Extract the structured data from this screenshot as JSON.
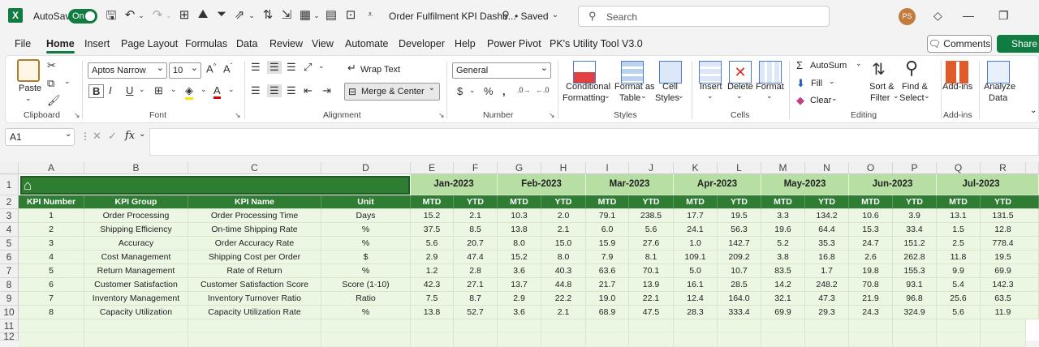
{
  "app": {
    "logo": "X",
    "autosave_label": "AutoSave",
    "autosave_state": "On",
    "doc_title": "Order Fulfilment KPI Dashb...",
    "save_status": "• Saved",
    "search_placeholder": "Search",
    "user_initials": "PS"
  },
  "tabs": [
    "File",
    "Home",
    "Insert",
    "Page Layout",
    "Formulas",
    "Data",
    "Review",
    "View",
    "Automate",
    "Developer",
    "Help",
    "Power Pivot",
    "PK's Utility Tool V3.0"
  ],
  "active_tab": "Home",
  "comments_label": "Comments",
  "share_label": "Share",
  "ribbon": {
    "clipboard": {
      "paste": "Paste",
      "label": "Clipboard"
    },
    "font": {
      "name": "Aptos Narrow",
      "size": "10",
      "label": "Font"
    },
    "alignment": {
      "wrap": "Wrap Text",
      "merge": "Merge & Center",
      "label": "Alignment"
    },
    "number": {
      "format": "General",
      "label": "Number"
    },
    "styles": {
      "cond1": "Conditional",
      "cond2": "Formatting",
      "fmt1": "Format as",
      "fmt2": "Table",
      "cell1": "Cell",
      "cell2": "Styles",
      "label": "Styles"
    },
    "cells": {
      "insert": "Insert",
      "delete": "Delete",
      "format": "Format",
      "label": "Cells"
    },
    "editing": {
      "autosum": "AutoSum",
      "fill": "Fill",
      "clear": "Clear",
      "sort1": "Sort &",
      "sort2": "Filter",
      "find1": "Find &",
      "find2": "Select",
      "label": "Editing"
    },
    "addins": {
      "addins": "Add-ins",
      "label": "Add-ins"
    },
    "analyze": {
      "l1": "Analyze",
      "l2": "Data"
    }
  },
  "formula_bar": {
    "name_box": "A1",
    "fx": "fx",
    "value": ""
  },
  "sheet": {
    "columns": [
      "A",
      "B",
      "C",
      "D",
      "E",
      "F",
      "G",
      "H",
      "I",
      "J",
      "K",
      "L",
      "M",
      "N",
      "O",
      "P",
      "Q",
      "R"
    ],
    "rows": [
      "1",
      "2",
      "3",
      "4",
      "5",
      "6",
      "7",
      "8",
      "9",
      "10",
      "11",
      "12"
    ],
    "months": [
      "Jan-2023",
      "Feb-2023",
      "Mar-2023",
      "Apr-2023",
      "May-2023",
      "Jun-2023",
      "Jul-2023"
    ],
    "headers": [
      "KPI Number",
      "KPI Group",
      "KPI Name",
      "Unit"
    ],
    "sub_headers": [
      "MTD",
      "YTD"
    ],
    "kpis": [
      {
        "num": "1",
        "group": "Order Processing",
        "name": "Order Processing Time",
        "unit": "Days",
        "vals": [
          "15.2",
          "2.1",
          "10.3",
          "2.0",
          "79.1",
          "238.5",
          "17.7",
          "19.5",
          "3.3",
          "134.2",
          "10.6",
          "3.9",
          "13.1",
          "131.5"
        ]
      },
      {
        "num": "2",
        "group": "Shipping Efficiency",
        "name": "On-time Shipping Rate",
        "unit": "%",
        "vals": [
          "37.5",
          "8.5",
          "13.8",
          "2.1",
          "6.0",
          "5.6",
          "24.1",
          "56.3",
          "19.6",
          "64.4",
          "15.3",
          "33.4",
          "1.5",
          "12.8"
        ]
      },
      {
        "num": "3",
        "group": "Accuracy",
        "name": "Order Accuracy Rate",
        "unit": "%",
        "vals": [
          "5.6",
          "20.7",
          "8.0",
          "15.0",
          "15.9",
          "27.6",
          "1.0",
          "142.7",
          "5.2",
          "35.3",
          "24.7",
          "151.2",
          "2.5",
          "778.4"
        ]
      },
      {
        "num": "4",
        "group": "Cost Management",
        "name": "Shipping Cost per Order",
        "unit": "$",
        "vals": [
          "2.9",
          "47.4",
          "15.2",
          "8.0",
          "7.9",
          "8.1",
          "109.1",
          "209.2",
          "3.8",
          "16.8",
          "2.6",
          "262.8",
          "11.8",
          "19.5"
        ]
      },
      {
        "num": "5",
        "group": "Return Management",
        "name": "Rate of Return",
        "unit": "%",
        "vals": [
          "1.2",
          "2.8",
          "3.6",
          "40.3",
          "63.6",
          "70.1",
          "5.0",
          "10.7",
          "83.5",
          "1.7",
          "19.8",
          "155.3",
          "9.9",
          "69.9"
        ]
      },
      {
        "num": "6",
        "group": "Customer Satisfaction",
        "name": "Customer Satisfaction Score",
        "unit": "Score (1-10)",
        "vals": [
          "42.3",
          "27.1",
          "13.7",
          "44.8",
          "21.7",
          "13.9",
          "16.1",
          "28.5",
          "14.2",
          "248.2",
          "70.8",
          "93.1",
          "5.4",
          "142.3"
        ]
      },
      {
        "num": "7",
        "group": "Inventory Management",
        "name": "Inventory Turnover Ratio",
        "unit": "Ratio",
        "vals": [
          "7.5",
          "8.7",
          "2.9",
          "22.2",
          "19.0",
          "22.1",
          "12.4",
          "164.0",
          "32.1",
          "47.3",
          "21.9",
          "96.8",
          "25.6",
          "63.5"
        ]
      },
      {
        "num": "8",
        "group": "Capacity Utilization",
        "name": "Capacity Utilization Rate",
        "unit": "%",
        "vals": [
          "13.8",
          "52.7",
          "3.6",
          "2.1",
          "68.9",
          "47.5",
          "28.3",
          "333.4",
          "69.9",
          "29.3",
          "24.3",
          "324.9",
          "5.6",
          "11.9"
        ]
      }
    ]
  }
}
